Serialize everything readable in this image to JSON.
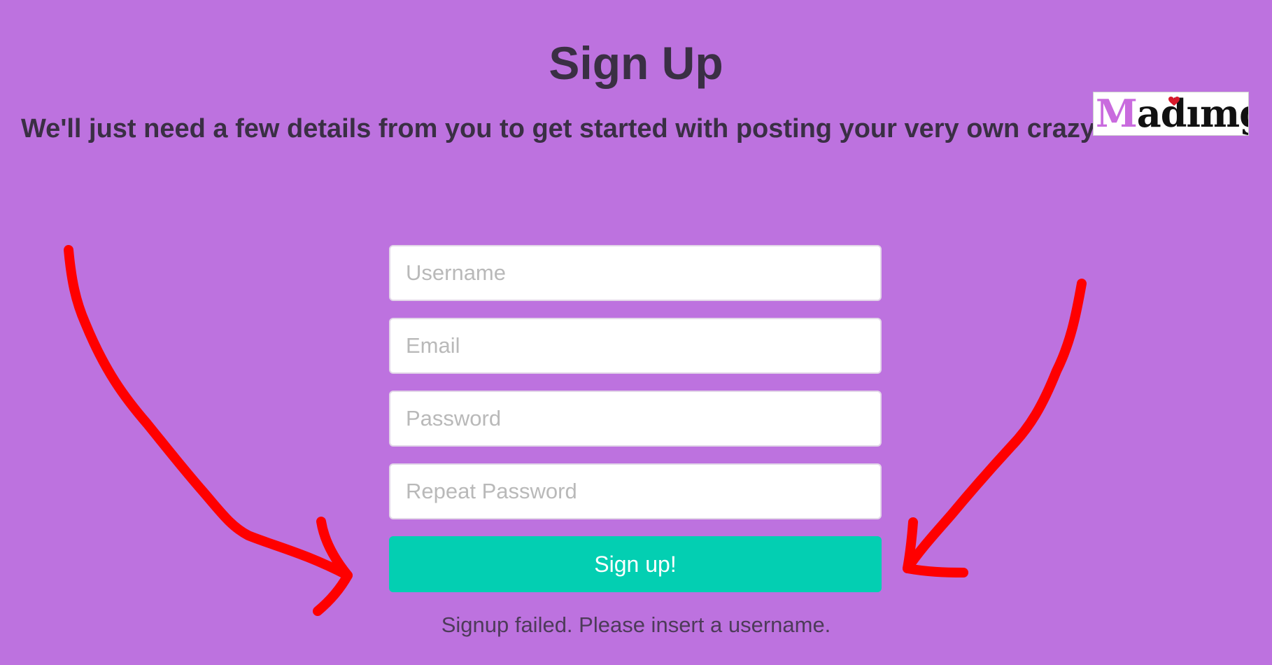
{
  "header": {
    "title": "Sign Up",
    "subtitle": "We'll just need a few details from you to get started with posting your very own crazy"
  },
  "logo": {
    "text": "Madimgz",
    "first_letter": "M",
    "rest_part1": "ad",
    "rest_i": "ı",
    "rest_part2": "mgz",
    "accent_color": "#c96bde",
    "heart_color": "#d7192a"
  },
  "form": {
    "username_placeholder": "Username",
    "email_placeholder": "Email",
    "password_placeholder": "Password",
    "repeat_password_placeholder": "Repeat Password",
    "submit_label": "Sign up!"
  },
  "status": {
    "error_message": "Signup failed. Please insert a username."
  },
  "colors": {
    "background": "#bd72df",
    "button": "#03cfb2",
    "annotation_arrows": "#ff0000"
  }
}
